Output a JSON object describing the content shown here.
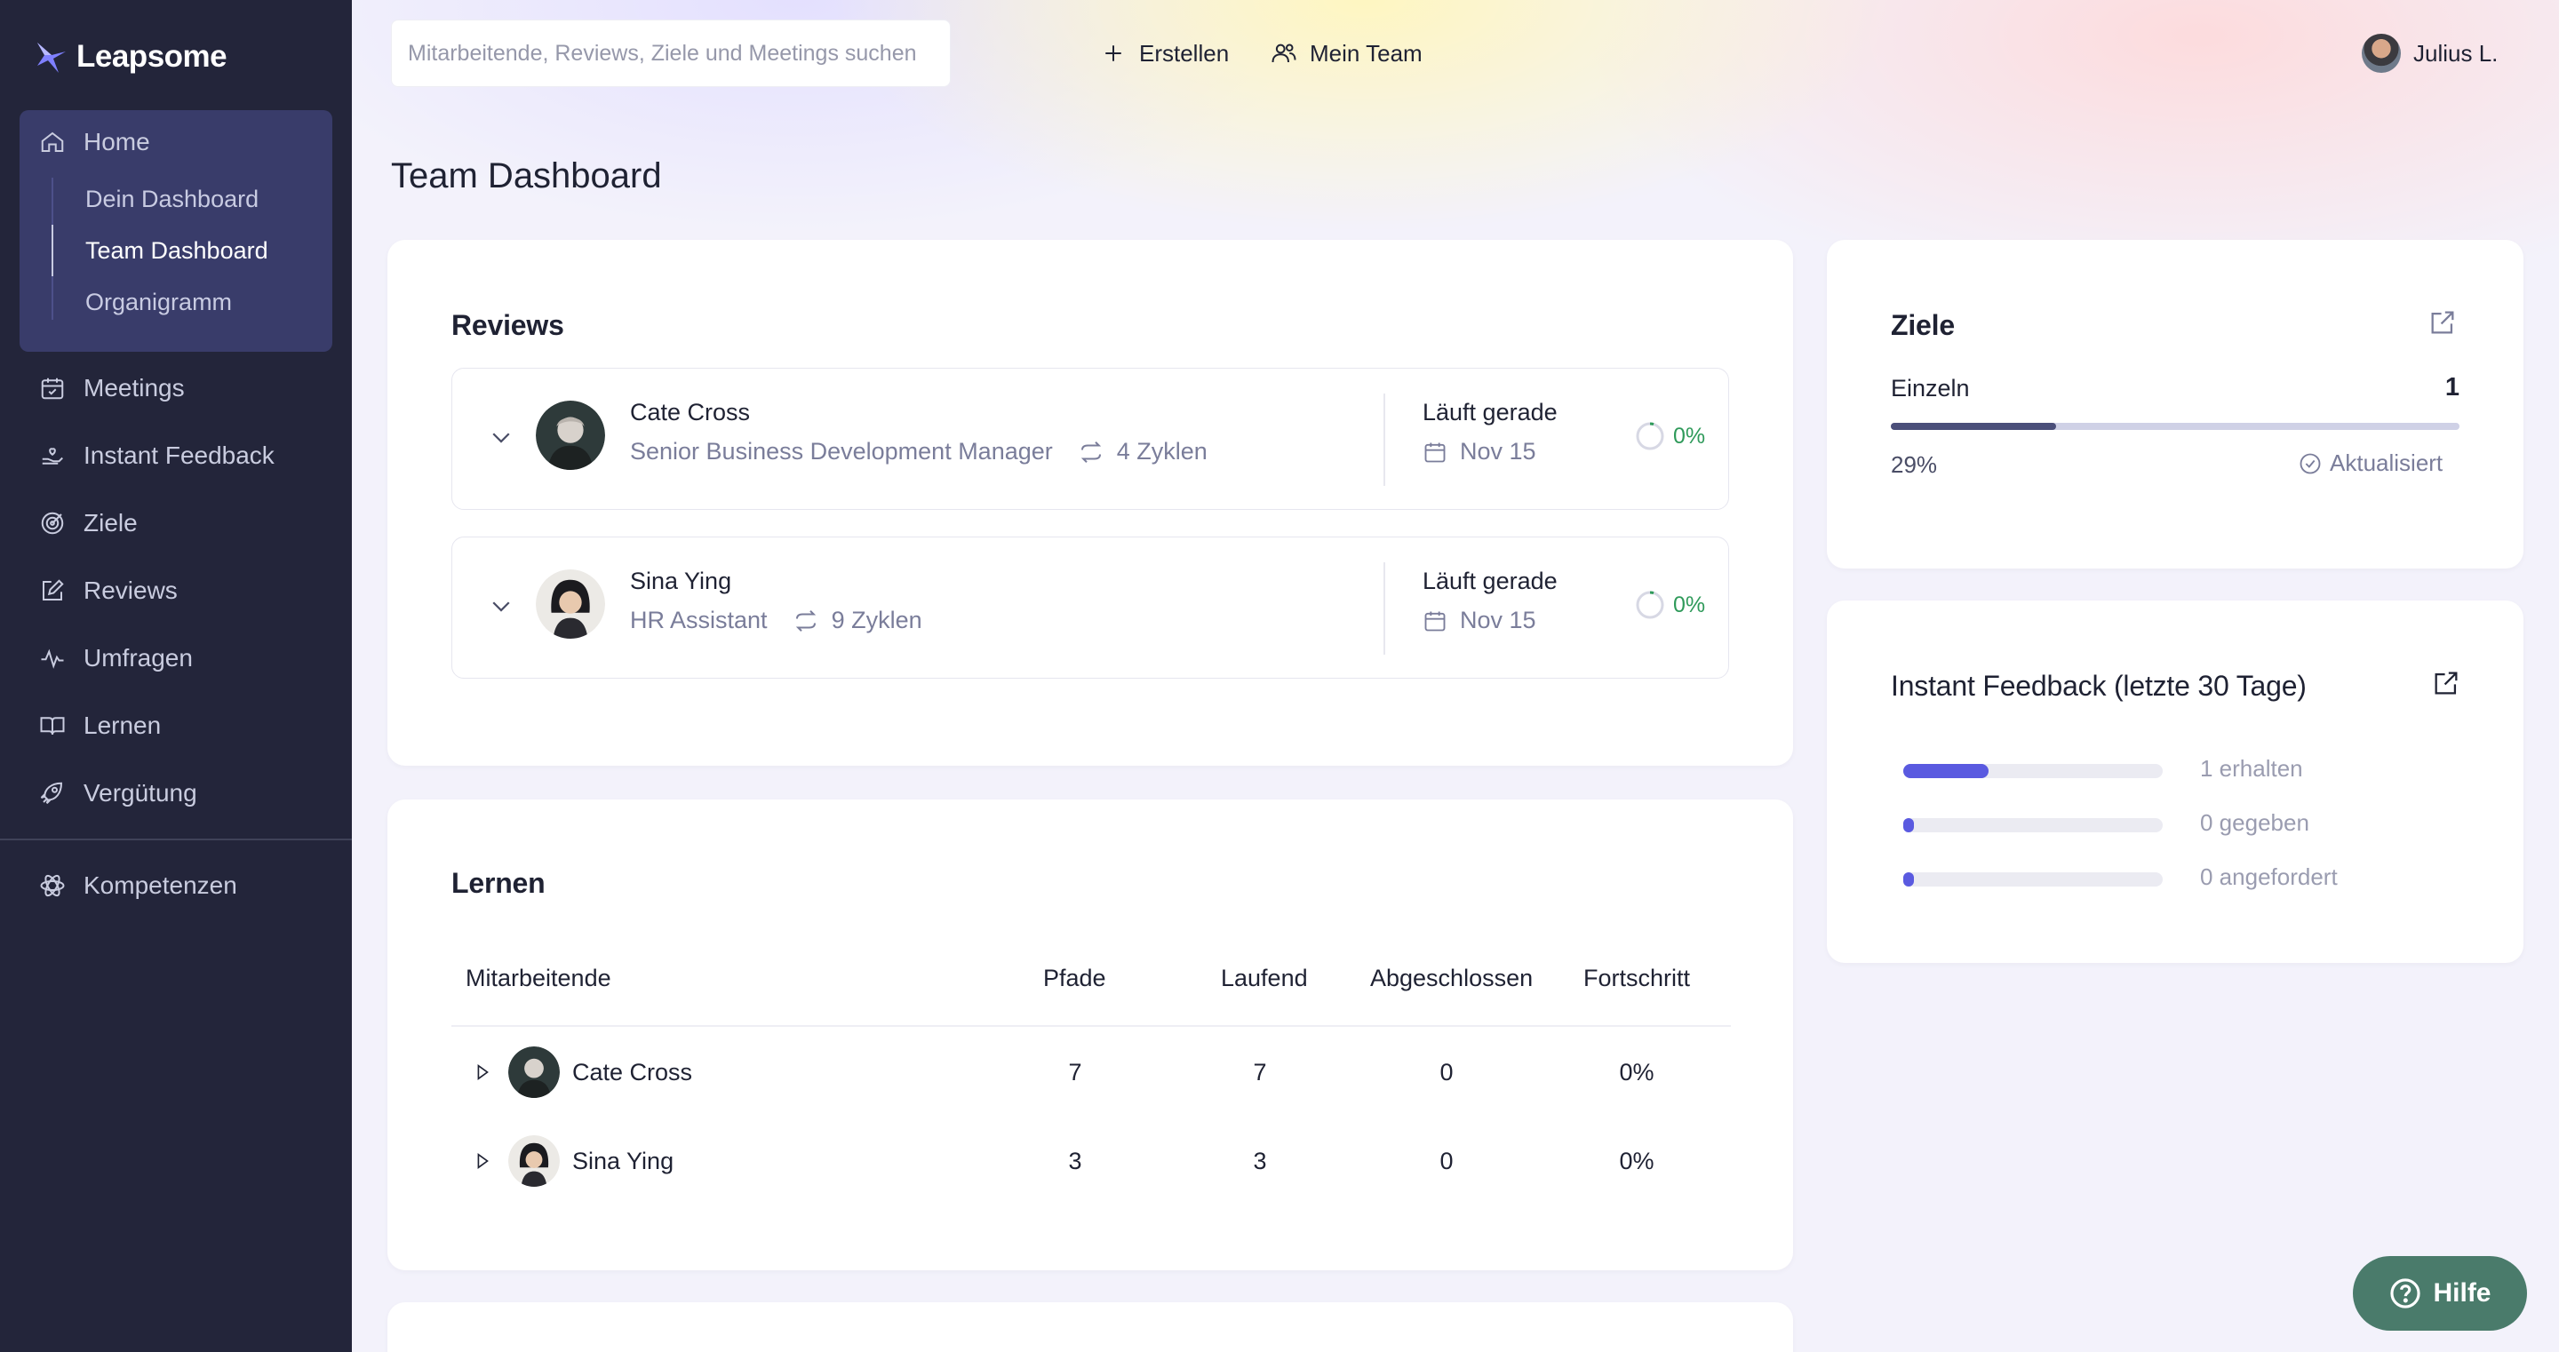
{
  "brand": {
    "name": "Leapsome"
  },
  "sidebar": {
    "home": {
      "label": "Home",
      "icon": "home-icon"
    },
    "home_sub": [
      {
        "label": "Dein Dashboard"
      },
      {
        "label": "Team Dashboard",
        "active": true
      },
      {
        "label": "Organigramm"
      }
    ],
    "items": [
      {
        "label": "Meetings",
        "icon": "calendar-check-icon"
      },
      {
        "label": "Instant Feedback",
        "icon": "hand-heart-icon"
      },
      {
        "label": "Ziele",
        "icon": "target-icon"
      },
      {
        "label": "Reviews",
        "icon": "edit-square-icon"
      },
      {
        "label": "Umfragen",
        "icon": "activity-icon"
      },
      {
        "label": "Lernen",
        "icon": "book-open-icon"
      },
      {
        "label": "Vergütung",
        "icon": "rocket-icon"
      }
    ],
    "bottom_items": [
      {
        "label": "Kompetenzen",
        "icon": "atom-icon"
      }
    ]
  },
  "topbar": {
    "search_placeholder": "Mitarbeitende, Reviews, Ziele und Meetings suchen",
    "create_label": "Erstellen",
    "team_label": "Mein Team",
    "user_label": "Julius L."
  },
  "page": {
    "title": "Team Dashboard"
  },
  "reviews": {
    "title": "Reviews",
    "rows": [
      {
        "name": "Cate Cross",
        "role": "Senior Business Development Manager",
        "cycles": "4 Zyklen",
        "status": "Läuft gerade",
        "date": "Nov 15",
        "progress": "0%"
      },
      {
        "name": "Sina Ying",
        "role": "HR Assistant",
        "cycles": "9 Zyklen",
        "status": "Läuft gerade",
        "date": "Nov 15",
        "progress": "0%"
      }
    ]
  },
  "learning": {
    "title": "Lernen",
    "columns": [
      "Mitarbeitende",
      "Pfade",
      "Laufend",
      "Abgeschlossen",
      "Fortschritt"
    ],
    "rows": [
      {
        "name": "Cate Cross",
        "paths": "7",
        "ongoing": "7",
        "completed": "0",
        "progress": "0%"
      },
      {
        "name": "Sina Ying",
        "paths": "3",
        "ongoing": "3",
        "completed": "0",
        "progress": "0%"
      }
    ]
  },
  "goals": {
    "title": "Ziele",
    "type_label": "Einzeln",
    "count": "1",
    "percent": "29%",
    "progress_fraction": 0.29,
    "updated_label": "Aktualisiert"
  },
  "feedback": {
    "title": "Instant Feedback (letzte 30 Tage)",
    "rows": [
      {
        "label": "1 erhalten",
        "fill_fraction": 0.33
      },
      {
        "label": "0 gegeben",
        "fill_fraction": 0.04
      },
      {
        "label": "0 angefordert",
        "fill_fraction": 0.04
      }
    ]
  },
  "help": {
    "label": "Hilfe"
  },
  "colors": {
    "sidebar_bg": "#23253a",
    "sidebar_active_group": "#393c6a",
    "accent": "#5a5ae0",
    "success": "#2f9a5a",
    "help_button": "#4a7b6b"
  }
}
